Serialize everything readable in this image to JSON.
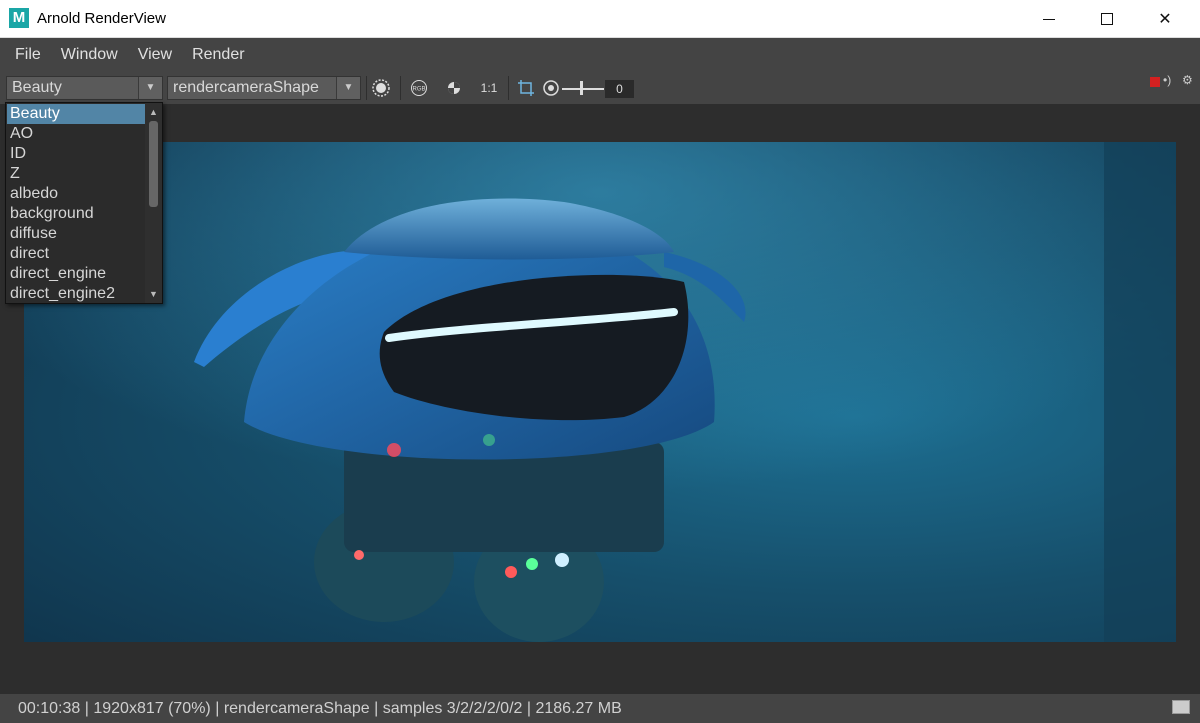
{
  "window": {
    "title": "Arnold RenderView",
    "icon_letter": "M"
  },
  "menubar": {
    "items": [
      "File",
      "Window",
      "View",
      "Render"
    ]
  },
  "toolbar": {
    "aov_selected": "Beauty",
    "camera_selected": "rendercameraShape",
    "zoom_label": "1:1",
    "exposure_value": "0",
    "exposure_level": 0.45,
    "icons": [
      "render-icon",
      "rgb-channels-icon",
      "color-toggle-icon",
      "crop-region-icon",
      "exposure-icon",
      "stop-render-icon",
      "isolate-icon",
      "settings-gear-icon"
    ],
    "rgb_label": "RGB"
  },
  "aov_dropdown": {
    "items": [
      "Beauty",
      "AO",
      "ID",
      "Z",
      "albedo",
      "background",
      "diffuse",
      "direct",
      "direct_engine",
      "direct_engine2"
    ],
    "selected_index": 0
  },
  "colors": {
    "selection": "#5285a6",
    "stop_button": "#d42020",
    "render_bg": "#164f6b"
  },
  "status": {
    "time": "00:10:38",
    "resolution": "1920x817 (70%)",
    "camera": "rendercameraShape",
    "samples": "samples 3/2/2/2/0/2",
    "memory": "2186.27 MB"
  }
}
